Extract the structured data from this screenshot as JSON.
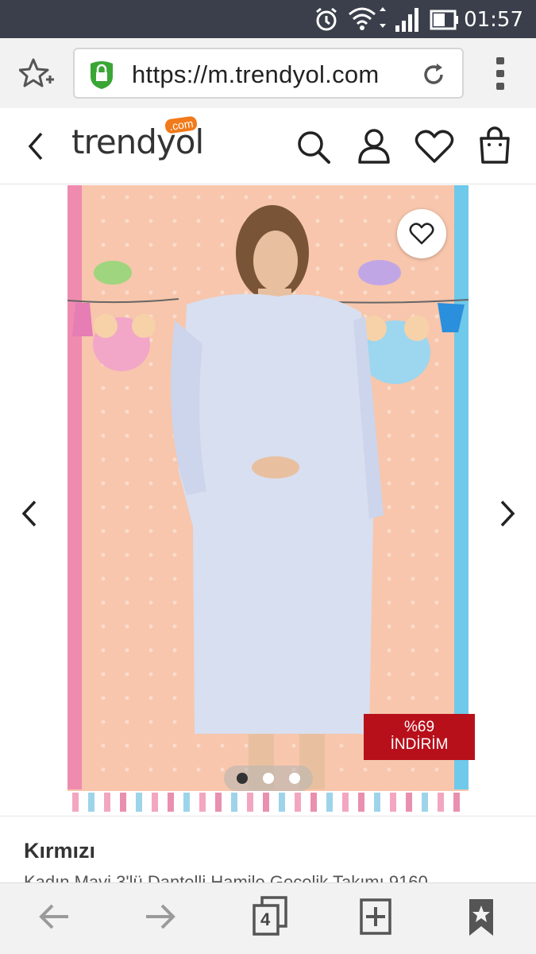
{
  "status_bar": {
    "time": "01:57",
    "icons": [
      "alarm-icon",
      "wifi-icon",
      "signal-icon",
      "battery-icon"
    ]
  },
  "browser": {
    "url": "https://m.trendyol.com",
    "tab_count": "4",
    "icons": [
      "bookmark-add-icon",
      "lock-icon",
      "reload-icon",
      "overflow-menu-icon"
    ]
  },
  "header": {
    "logo_text": "trendyol",
    "logo_suffix": ".com",
    "icons": [
      "back-icon",
      "search-icon",
      "user-icon",
      "heart-icon",
      "shopping-bag-icon"
    ]
  },
  "product": {
    "discount_line1": "%69",
    "discount_line2": "İNDİRİM",
    "brand": "Kırmızı",
    "name": "Kadın Mavi 3'lü Dantelli Hamile Gecelik Takımı 9160",
    "carousel": {
      "slide_count": 3,
      "active_slide": 1
    },
    "accent_color": "#b8101b"
  },
  "bottom_nav": {
    "icons": [
      "back-arrow-icon",
      "forward-arrow-icon",
      "tabs-icon",
      "new-tab-icon",
      "bookmarks-icon"
    ]
  }
}
